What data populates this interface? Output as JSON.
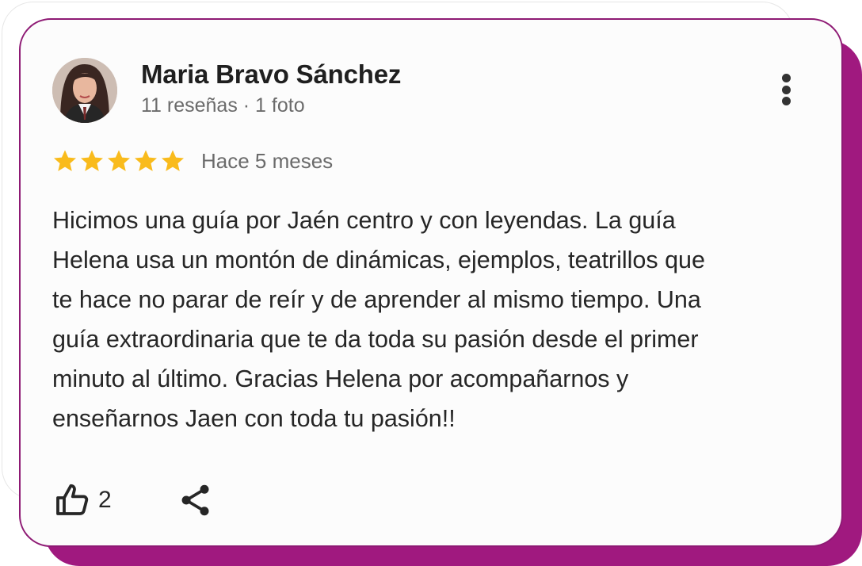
{
  "review": {
    "author_name": "Maria Bravo Sánchez",
    "author_meta": "11 reseñas · 1 foto",
    "rating": 5,
    "rating_max": 5,
    "time_ago": "Hace 5 meses",
    "text": "Hicimos una guía por Jaén centro y con leyendas. La guía\nHelena usa un montón de dinámicas, ejemplos, teatrillos que\nte hace no parar de reír y de aprender al mismo tiempo. Una\nguía extraordinaria que te da toda su pasión desde el primer\nminuto al último. Gracias Helena por acompañarnos y\nenseñarnos Jaen con toda tu pasión!!",
    "like_count": "2"
  },
  "icons": {
    "more": "more-vertical-icon",
    "like": "thumbs-up-icon",
    "share": "share-icon",
    "star": "star-icon"
  },
  "colors": {
    "accent": "#a0197f",
    "star": "#f9bb1c",
    "text": "#262626",
    "muted": "#6b6b6b"
  }
}
